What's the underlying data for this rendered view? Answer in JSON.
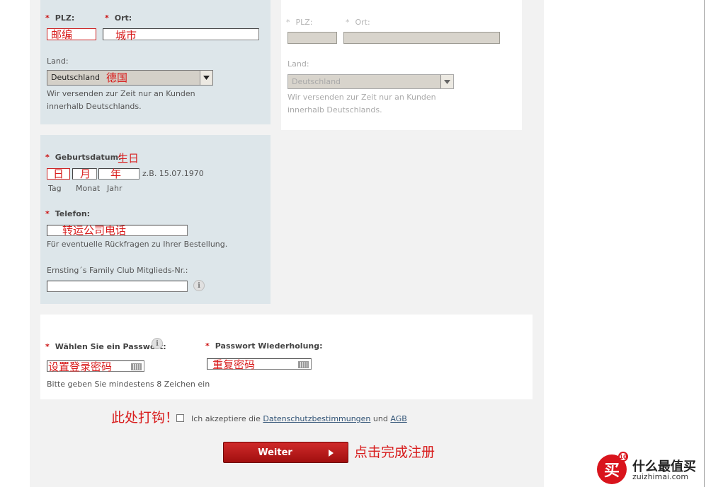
{
  "colors": {
    "required": "#cc1010",
    "annotation": "#d81c1c",
    "button": "#b51818",
    "panel": "#dde6ea"
  },
  "address_left": {
    "plz_label": "PLZ:",
    "ort_label": "Ort:",
    "plz_annotation": "邮编",
    "ort_annotation": "城市",
    "land_label": "Land:",
    "land_value": "Deutschland",
    "land_annotation": "德国",
    "land_note": "Wir versenden zur Zeit nur an Kunden innerhalb Deutschlands."
  },
  "address_right": {
    "plz_label": "PLZ:",
    "ort_label": "Ort:",
    "land_label": "Land:",
    "land_value": "Deutschland",
    "land_note": "Wir versenden zur Zeit nur an Kunden innerhalb Deutschlands."
  },
  "birthday": {
    "label": "Geburtsdatum:",
    "annotation": "生日",
    "day_annotation": "日",
    "month_annotation": "月",
    "year_annotation": "年",
    "example": "z.B. 15.07.1970",
    "day_label": "Tag",
    "month_label": "Monat",
    "year_label": "Jahr"
  },
  "phone": {
    "label": "Telefon:",
    "annotation": "转运公司电话",
    "note": "Für eventuelle Rückfragen zu Ihrer Bestellung."
  },
  "club": {
    "label": "Ernsting´s Family Club Mitglieds-Nr.:"
  },
  "password": {
    "label": "Wählen Sie ein Passwort:",
    "annotation": "设置登录密码",
    "note": "Bitte geben Sie mindestens 8 Zeichen ein",
    "repeat_label": "Passwort Wiederholung:",
    "repeat_annotation": "重复密码"
  },
  "terms": {
    "annotation": "此处打钩！",
    "text_before": "Ich akzeptiere die",
    "privacy_link": "Datenschutzbestimmungen",
    "text_and": "und",
    "agb_link": "AGB"
  },
  "submit": {
    "label": "Weiter",
    "annotation": "点击完成注册"
  },
  "watermark": {
    "cn": "什么最值买",
    "url": "zuizhimai.com",
    "logo_char": "买",
    "badge": "10"
  },
  "required_mark": "*",
  "info_glyph": "i"
}
